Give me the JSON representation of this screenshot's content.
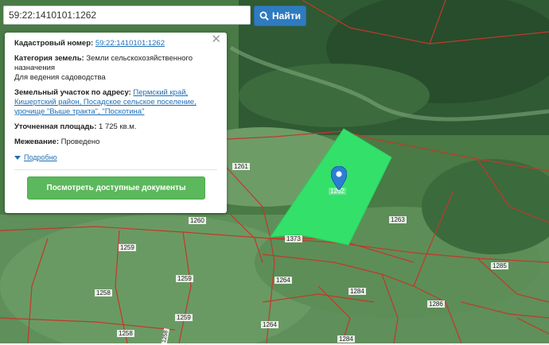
{
  "search": {
    "value": "59:22:1410101:1262",
    "button_label": "Найти"
  },
  "popup": {
    "cad_label": "Кадастровый номер:",
    "cad_value": "59:22:1410101:1262",
    "category_label": "Категория земель:",
    "category_value": "Земли сельскохозяйственного назначения",
    "usage": "Для ведения садоводства",
    "address_label": "Земельный участок по адресу:",
    "address_value": "Пермский край, Кишертский район, Посадское сельское поселение, урочище \"Выше тракта\", \"Поскотина\"",
    "area_label": "Уточненная площадь:",
    "area_value": "1 725 кв.м.",
    "survey_label": "Межевание:",
    "survey_value": "Проведено",
    "more_label": "Подробно",
    "docs_button": "Посмотреть доступные документы"
  },
  "parcels": [
    "1261",
    "1262",
    "1263",
    "1260",
    "1373",
    "1259",
    "1259",
    "1258",
    "1264",
    "1284",
    "1286",
    "1285",
    "1264",
    "1259",
    "1258",
    "1258",
    "1284"
  ],
  "colors": {
    "highlight": "#33e06a",
    "boundary": "#c0392b",
    "marker": "#2a7fd4"
  }
}
